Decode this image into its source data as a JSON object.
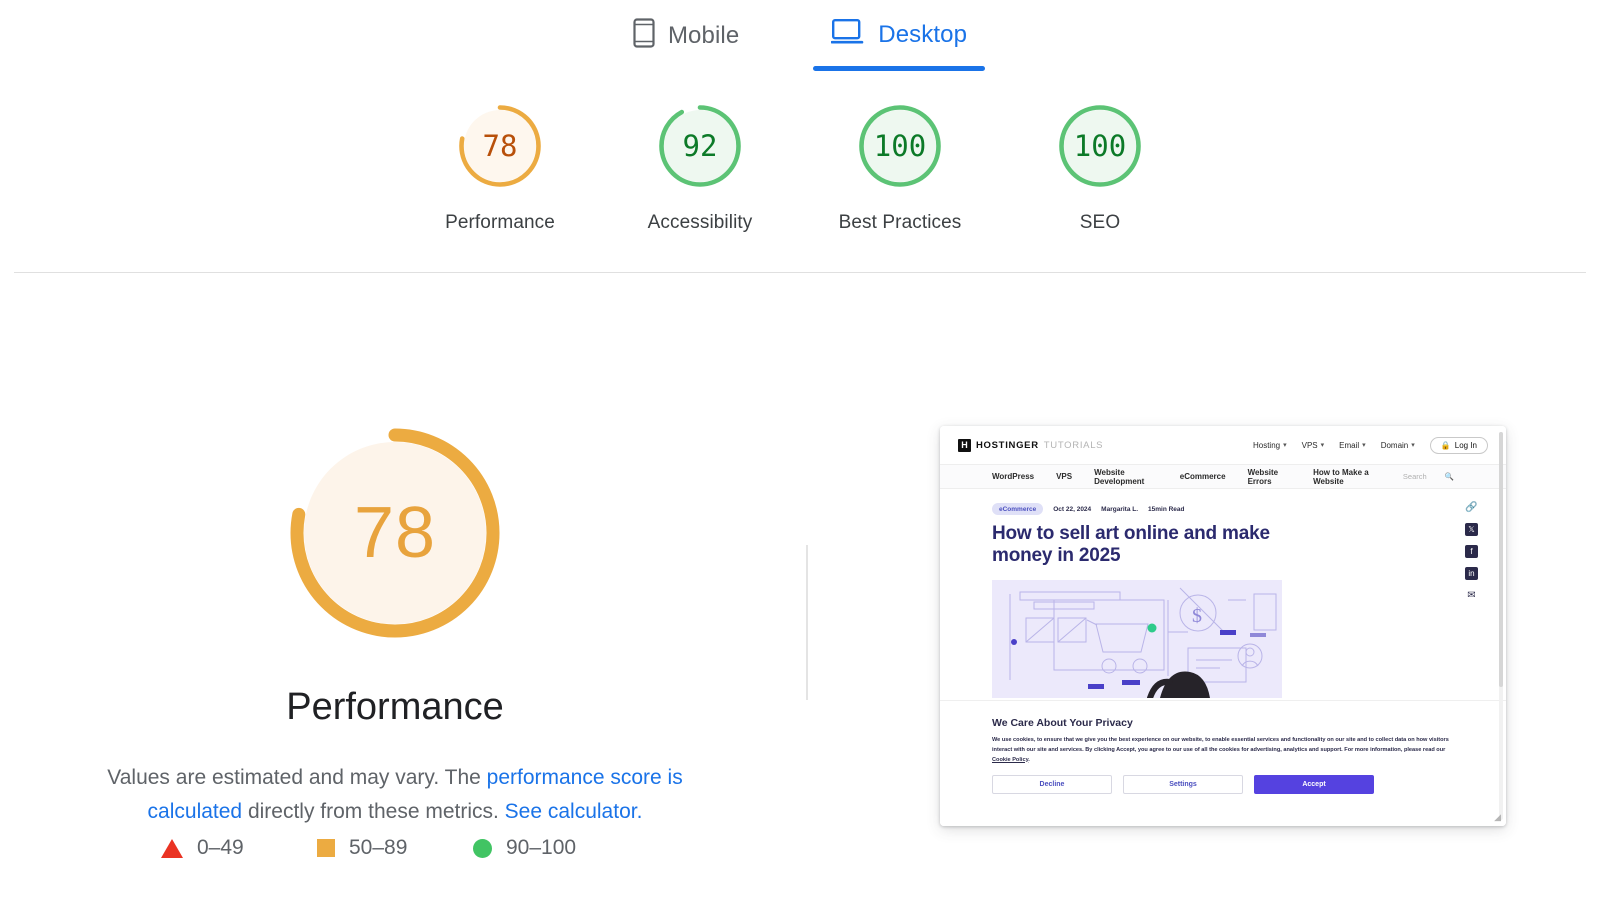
{
  "tabs": [
    {
      "label": "Mobile",
      "icon": "mobile-icon",
      "active": false
    },
    {
      "label": "Desktop",
      "icon": "desktop-icon",
      "active": true
    }
  ],
  "colors": {
    "blue": "#1a73e8",
    "orange_ring": "#ecab41",
    "orange_fill": "#fef7ee",
    "orange_text": "#b8500a",
    "green_ring": "#5cc375",
    "green_fill": "#eef8f0",
    "green_text": "#0c7a28",
    "red": "#ea3323",
    "big_number": "#e8a33d"
  },
  "scores": [
    {
      "name": "Performance",
      "value": "78",
      "numeric": 78,
      "status": "average"
    },
    {
      "name": "Accessibility",
      "value": "92",
      "numeric": 92,
      "status": "good"
    },
    {
      "name": "Best Practices",
      "value": "100",
      "numeric": 100,
      "status": "good"
    },
    {
      "name": "SEO",
      "value": "100",
      "numeric": 100,
      "status": "good"
    }
  ],
  "detail": {
    "score": "78",
    "numeric": 78,
    "title": "Performance",
    "desc_part1": "Values are estimated and may vary. The ",
    "desc_link1": "performance score is calculated",
    "desc_part2": " directly from these metrics. ",
    "desc_link2": "See calculator."
  },
  "legend": [
    {
      "shape": "triangle",
      "label": "0–49",
      "color": "#ea3323"
    },
    {
      "shape": "square",
      "label": "50–89",
      "color": "#ecab41"
    },
    {
      "shape": "circle",
      "label": "90–100",
      "color": "#41c463"
    }
  ],
  "screenshot": {
    "brand_mark": "H",
    "brand_name": "HOSTINGER",
    "brand_sub": "TUTORIALS",
    "topnav": [
      "Hosting",
      "VPS",
      "Email",
      "Domain"
    ],
    "login_label": "Log In",
    "subnav": [
      "WordPress",
      "VPS",
      "Website Development",
      "eCommerce",
      "Website Errors",
      "How to Make a Website"
    ],
    "search_placeholder": "Search",
    "article": {
      "category": "eCommerce",
      "date": "Oct 22, 2024",
      "author": "Margarita L.",
      "read_time": "15min Read",
      "headline": "How to sell art online and make money in 2025"
    },
    "share_icons": [
      "link-icon",
      "x-twitter-icon",
      "facebook-icon",
      "linkedin-icon",
      "email-icon"
    ],
    "cookie": {
      "title": "We Care About Your Privacy",
      "body_1": "We use cookies, to ensure that we give you the best experience on our website, to enable essential services and functionality on our site and to collect data on how visitors interact with our site and services. By clicking Accept, you agree to our use of all the cookies for advertising, analytics and support. For more information, please read our ",
      "body_link": "Cookie Policy",
      "body_2": ".",
      "decline": "Decline",
      "settings": "Settings",
      "accept": "Accept"
    }
  }
}
